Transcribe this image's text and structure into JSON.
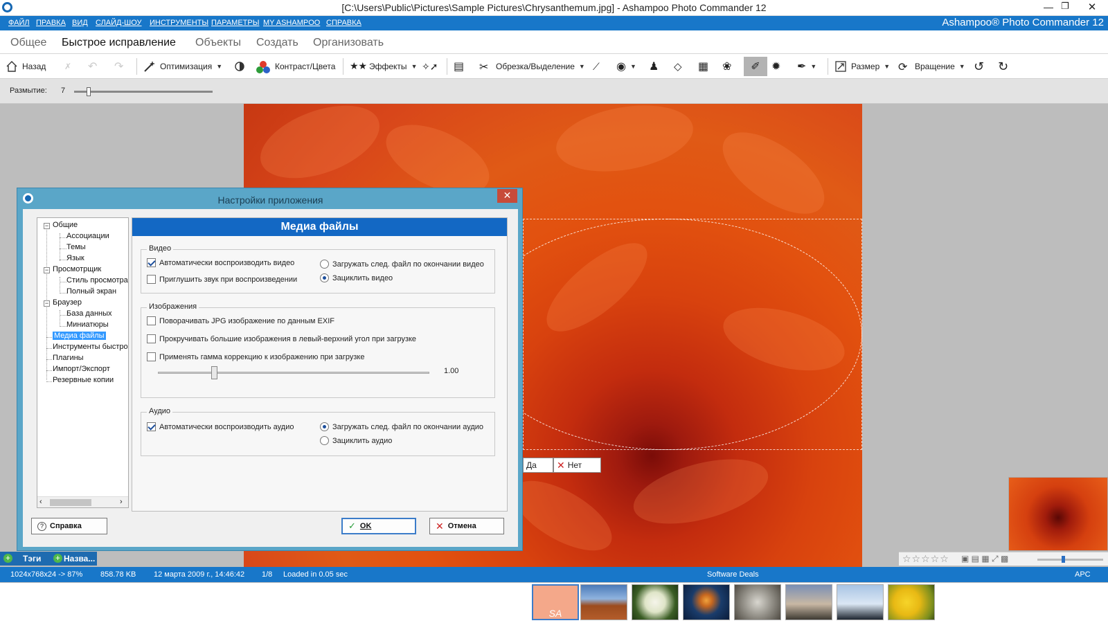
{
  "window": {
    "title": "[C:\\Users\\Public\\Pictures\\Sample Pictures\\Chrysanthemum.jpg] - Ashampoo Photo Commander 12"
  },
  "menu": {
    "items": [
      "ФАЙЛ",
      "ПРАВКА",
      "ВИД",
      "СЛАЙД-ШОУ",
      "ИНСТРУМЕНТЫ",
      "ПАРАМЕТРЫ",
      "MY ASHAMPOO",
      "СПРАВКА"
    ],
    "brand": "Ashampoo® Photo Commander 12"
  },
  "tabs": [
    "Общее",
    "Быстрое исправление",
    "Объекты",
    "Создать",
    "Организовать"
  ],
  "toolbar": {
    "back": "Назад",
    "optimize": "Оптимизация",
    "contrast": "Контраст/Цвета",
    "effects": "Эффекты",
    "crop": "Обрезка/Выделение",
    "size": "Размер",
    "rotate": "Вращение"
  },
  "options": {
    "blur_label": "Размытие:",
    "blur_value": "7"
  },
  "canvas": {
    "yes": "Да",
    "no": "Нет"
  },
  "dialog": {
    "title": "Настройки приложения",
    "close": "✕",
    "tree": [
      "Общие",
      "Ассоциации",
      "Темы",
      "Язык",
      "Просмотрщик",
      "Стиль просмотра",
      "Полный экран",
      "Браузер",
      "База данных",
      "Миниатюры",
      "Медиа файлы",
      "Инструменты быстро",
      "Плагины",
      "Импорт/Экспорт",
      "Резервные копии"
    ],
    "panel_title": "Медиа файлы",
    "video": {
      "label": "Видео",
      "autoplay": "Автоматически воспроизводить видео",
      "mute": "Приглушить звук при воспроизведении",
      "load_next": "Загружать след. файл по окончании видео",
      "loop": "Зациклить видео"
    },
    "images": {
      "label": "Изображения",
      "rotate_exif": "Поворачивать JPG изображение по данным EXIF",
      "scroll_large": "Прокручивать большие изображения в левый-верхний угол при загрузке",
      "gamma": "Применять гамма коррекцию к изображению при загрузке",
      "gamma_value": "1.00"
    },
    "audio": {
      "label": "Аудио",
      "autoplay": "Автоматически воспроизводить аудио",
      "load_next": "Загружать след. файл по окончании аудио",
      "loop": "Зациклить аудио"
    },
    "help": "Справка",
    "ok": "OK",
    "cancel": "Отмена"
  },
  "sidebar_strip": {
    "tags": "Тэги",
    "name": "Назва..."
  },
  "status": {
    "dims": "1024x768x24 -> 87%",
    "size": "858.78 KB",
    "date": "12 марта 2009 г., 14:46:42",
    "index": "1/8",
    "loaded": "Loaded in 0.05 sec",
    "deals": "Software Deals",
    "lang": "APC"
  },
  "filmstrip": {
    "first_label": "SA"
  }
}
